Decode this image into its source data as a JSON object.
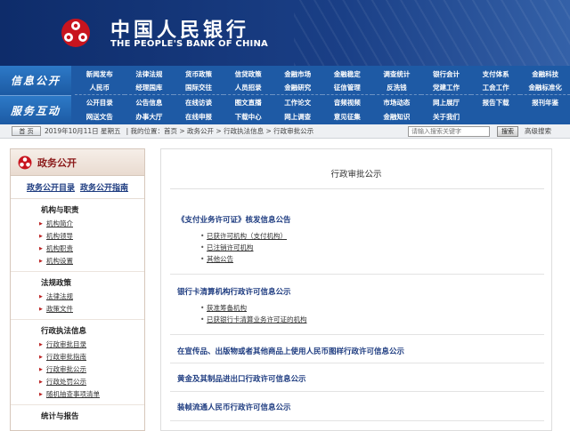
{
  "header": {
    "bank_cn": "中国人民银行",
    "bank_en": "THE PEOPLE'S BANK OF CHINA"
  },
  "nav": {
    "label_public": "信息公开",
    "label_service": "服务互动",
    "rows": [
      [
        "新闻发布",
        "法律法规",
        "货币政策",
        "信贷政策",
        "金融市场",
        "金融稳定",
        "调查统计",
        "银行会计",
        "支付体系",
        "金融科技"
      ],
      [
        "人民币",
        "经理国库",
        "国际交往",
        "人员招录",
        "金融研究",
        "征信管理",
        "反洗钱",
        "党建工作",
        "工会工作",
        "金融标准化"
      ],
      [
        "公开目录",
        "公告信息",
        "在线访谈",
        "图文直播",
        "工作论文",
        "音频视频",
        "市场动态",
        "网上展厅",
        "报告下载",
        "报刊年鉴"
      ],
      [
        "网送文告",
        "办事大厅",
        "在线申报",
        "下载中心",
        "网上调查",
        "意见征集",
        "金融知识",
        "关于我们",
        "",
        ""
      ]
    ]
  },
  "crumb": {
    "home": "首 页",
    "date": "2019年10月11日 星期五",
    "location_label": "| 我的位置：",
    "path": [
      "首页",
      "政务公开",
      "行政执法信息",
      "行政审批公示"
    ],
    "search_placeholder": "请输入搜索关键字",
    "search_btn": "搜索",
    "advanced": "高级搜索"
  },
  "left": {
    "title": "政务公开",
    "links": [
      "政务公开目录",
      "政务公开指南"
    ],
    "sections": [
      {
        "title": "机构与职责",
        "items": [
          "机构简介",
          "机构领导",
          "机构职责",
          "机构设置"
        ]
      },
      {
        "title": "法规政策",
        "items": [
          "法律法规",
          "政策文件"
        ]
      },
      {
        "title": "行政执法信息",
        "items": [
          "行政审批目录",
          "行政审批指南",
          "行政审批公示",
          "行政处罚公示",
          "随机抽查事项清单"
        ]
      },
      {
        "title": "统计与报告",
        "items": []
      }
    ]
  },
  "main": {
    "title": "行政审批公示",
    "blocks": [
      {
        "title": "《支付业务许可证》核发信息公告",
        "items": [
          "已获许可机构（支付机构）",
          "已注销许可机构",
          "其他公告"
        ]
      },
      {
        "title": "银行卡清算机构行政许可信息公示",
        "items": [
          "获准筹备机构",
          "已获银行卡清算业务许可证的机构"
        ]
      },
      {
        "title": "在宣传品、出版物或者其他商品上使用人民币图样行政许可信息公示",
        "items": []
      },
      {
        "title": "黄金及其制品进出口行政许可信息公示",
        "items": []
      },
      {
        "title": "装帧流通人民币行政许可信息公示",
        "items": []
      }
    ]
  },
  "colors": {
    "banner": "#1a3f86",
    "nav": "#1e5aa5",
    "accent_red": "#c8141e",
    "link_blue": "#1e3c80"
  }
}
